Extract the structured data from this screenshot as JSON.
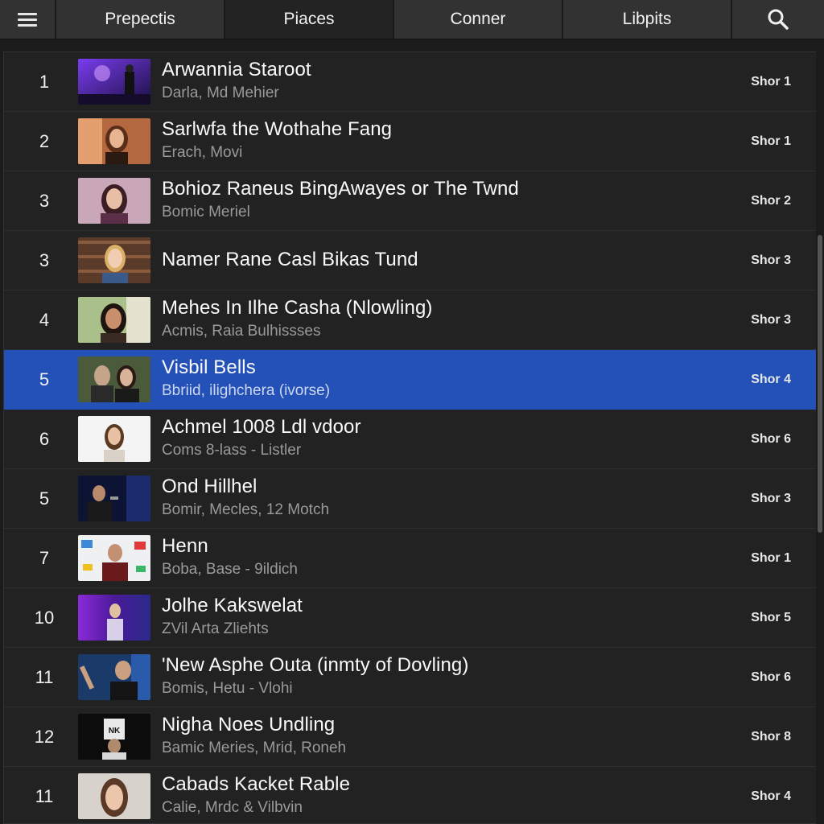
{
  "toolbar": {
    "menu_icon": "hamburger-menu-icon",
    "tabs": [
      {
        "label": "Prepectis"
      },
      {
        "label": "Piaces"
      },
      {
        "label": "Conner"
      },
      {
        "label": "Libpits"
      }
    ],
    "active_tab": "Piaces",
    "search_icon": "search-icon"
  },
  "colors": {
    "selected_row": "#2451b8",
    "background": "#1b1b1b",
    "row_background": "#222222"
  },
  "list": {
    "items": [
      {
        "num": "1",
        "title": "Arwannia Staroot",
        "subtitle": "Darla, Md Mehier",
        "meta": "Shor 1"
      },
      {
        "num": "2",
        "title": "Sarlwfa the Wothahe Fang",
        "subtitle": "Erach, Movi",
        "meta": "Shor 1"
      },
      {
        "num": "3",
        "title": "Bohioz Raneus BingAwayes or The Twnd",
        "subtitle": "Bomic Meriel",
        "meta": "Shor 2"
      },
      {
        "num": "3",
        "title": "Namer Rane Casl Bikas Tund",
        "subtitle": "",
        "meta": "Shor 3"
      },
      {
        "num": "4",
        "title": "Mehes In Ilhe Casha (Nlowling)",
        "subtitle": "Acmis, Raia Bulhissses",
        "meta": "Shor 3"
      },
      {
        "num": "5",
        "title": "Visbil Bells",
        "subtitle": "Bbriid, ilighchera (ivorse)",
        "meta": "Shor 4",
        "selected": true
      },
      {
        "num": "6",
        "title": "Achmel 1008 Ldl vdoor",
        "subtitle": "Coms 8-lass - Listler",
        "meta": "Shor 6"
      },
      {
        "num": "5",
        "title": "Ond Hillhel",
        "subtitle": "Bomir, Mecles, 12 Motch",
        "meta": "Shor 3"
      },
      {
        "num": "7",
        "title": "Henn",
        "subtitle": "Boba, Base - 9ildich",
        "meta": "Shor 1"
      },
      {
        "num": "10",
        "title": "Jolhe Kakswelat",
        "subtitle": "ZVil Arta Zliehts",
        "meta": "Shor 5"
      },
      {
        "num": "11",
        "title": "'New Asphe Outa (inmty of Dovling)",
        "subtitle": "Bomis, Hetu - Vlohi",
        "meta": "Shor 6"
      },
      {
        "num": "12",
        "title": "Nigha Noes Undling",
        "subtitle": "Bamic Meries, Mrid, Roneh",
        "meta": "Shor 8"
      },
      {
        "num": "11",
        "title": "Cabads Kacket Rable",
        "subtitle": "Calie, Mrdc & Vilbvin",
        "meta": "Shor 4"
      }
    ]
  },
  "thumb_text": "NK"
}
